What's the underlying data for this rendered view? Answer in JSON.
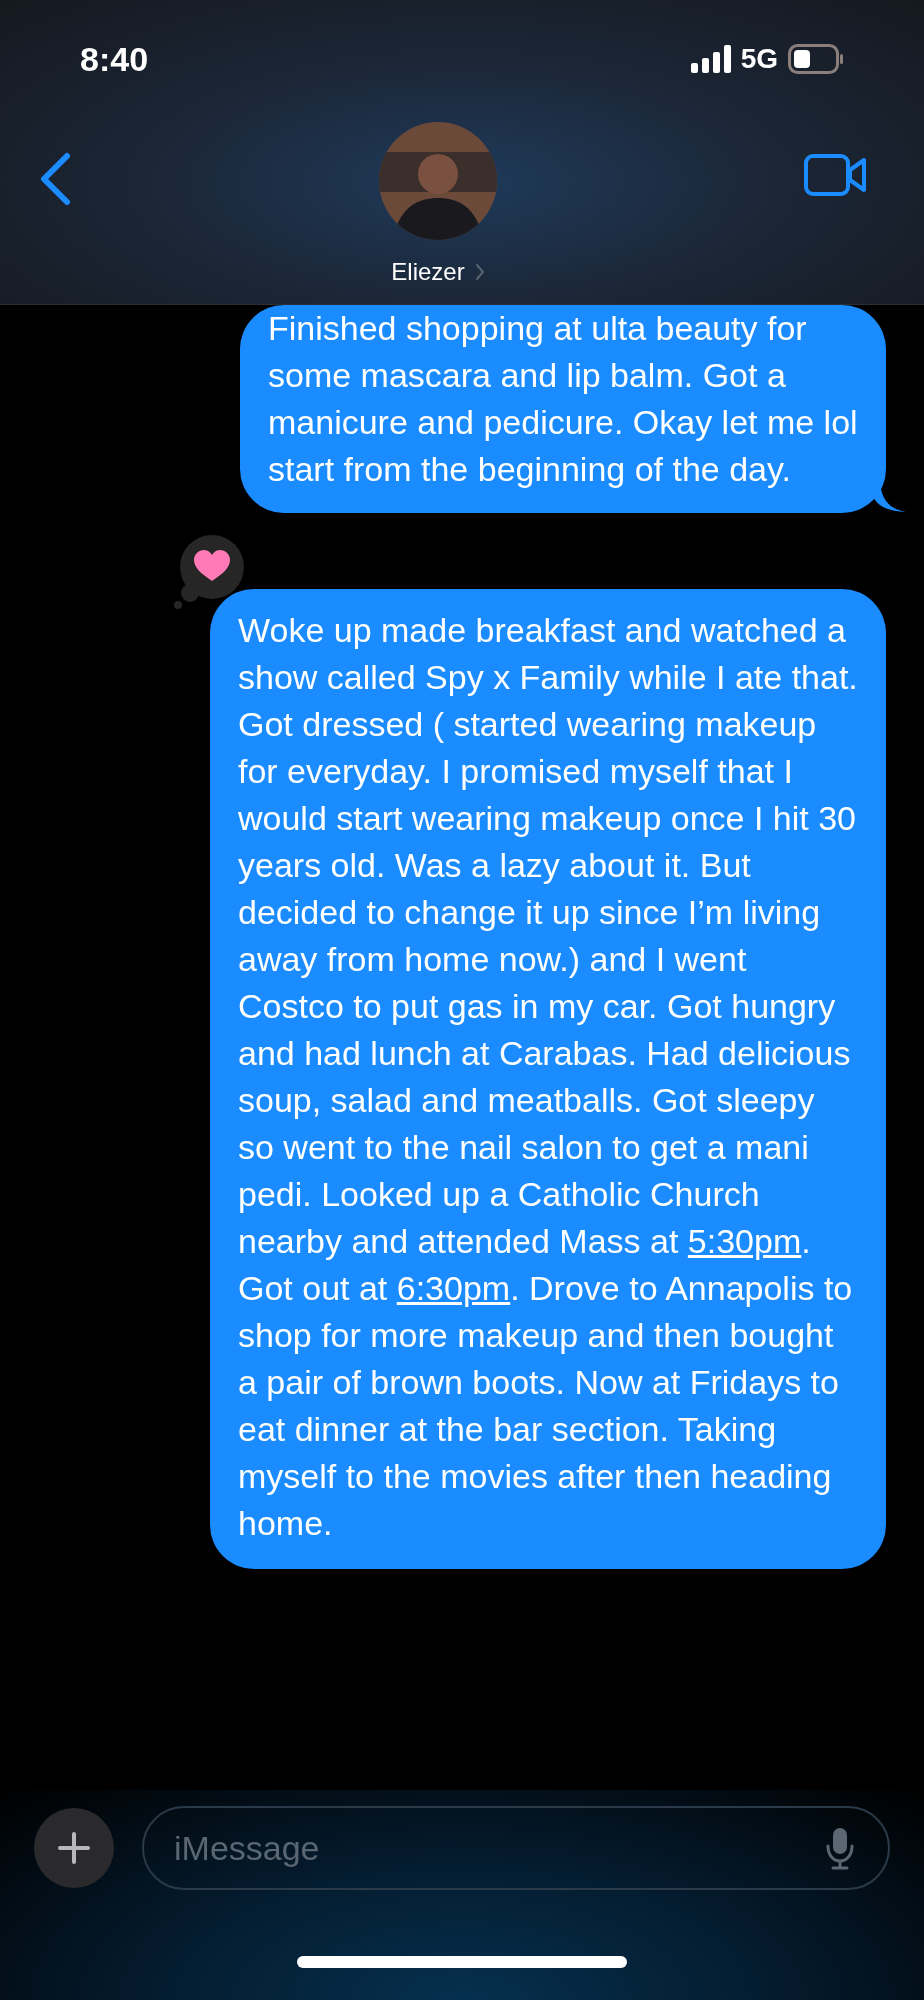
{
  "status_bar": {
    "time": "8:40",
    "network": "5G"
  },
  "header": {
    "contact_name": "Eliezer"
  },
  "messages": [
    {
      "tapback": false,
      "segments": [
        {
          "kind": "text",
          "text": "Finished shopping at ulta beauty for some mascara and lip balm. Got a manicure and pedicure. Okay let me lol start from the beginning of the day."
        }
      ]
    },
    {
      "tapback": true,
      "segments": [
        {
          "kind": "text",
          "text": "Woke up made breakfast and watched a show called Spy x Family while I ate that. Got dressed ( started wearing makeup for everyday. I promised myself that I would start wearing makeup once I hit 30 years old. Was a lazy about it. But decided to change it up since I’m living away from home now.) and I went Costco to put gas in my car. Got hungry and had lunch at Carabas. Had delicious soup, salad and meatballs. Got sleepy so went to the nail salon to get a mani pedi. Looked up a Catholic Church nearby and attended Mass at "
        },
        {
          "kind": "link",
          "text": "5:30pm"
        },
        {
          "kind": "text",
          "text": ". Got out at "
        },
        {
          "kind": "link",
          "text": "6:30pm"
        },
        {
          "kind": "text",
          "text": ". Drove to Annapolis to shop for more makeup and then bought a pair of brown boots. Now at Fridays to eat dinner at the bar section. Taking myself to the movies after then heading home."
        }
      ]
    }
  ],
  "composer": {
    "placeholder": "iMessage"
  }
}
